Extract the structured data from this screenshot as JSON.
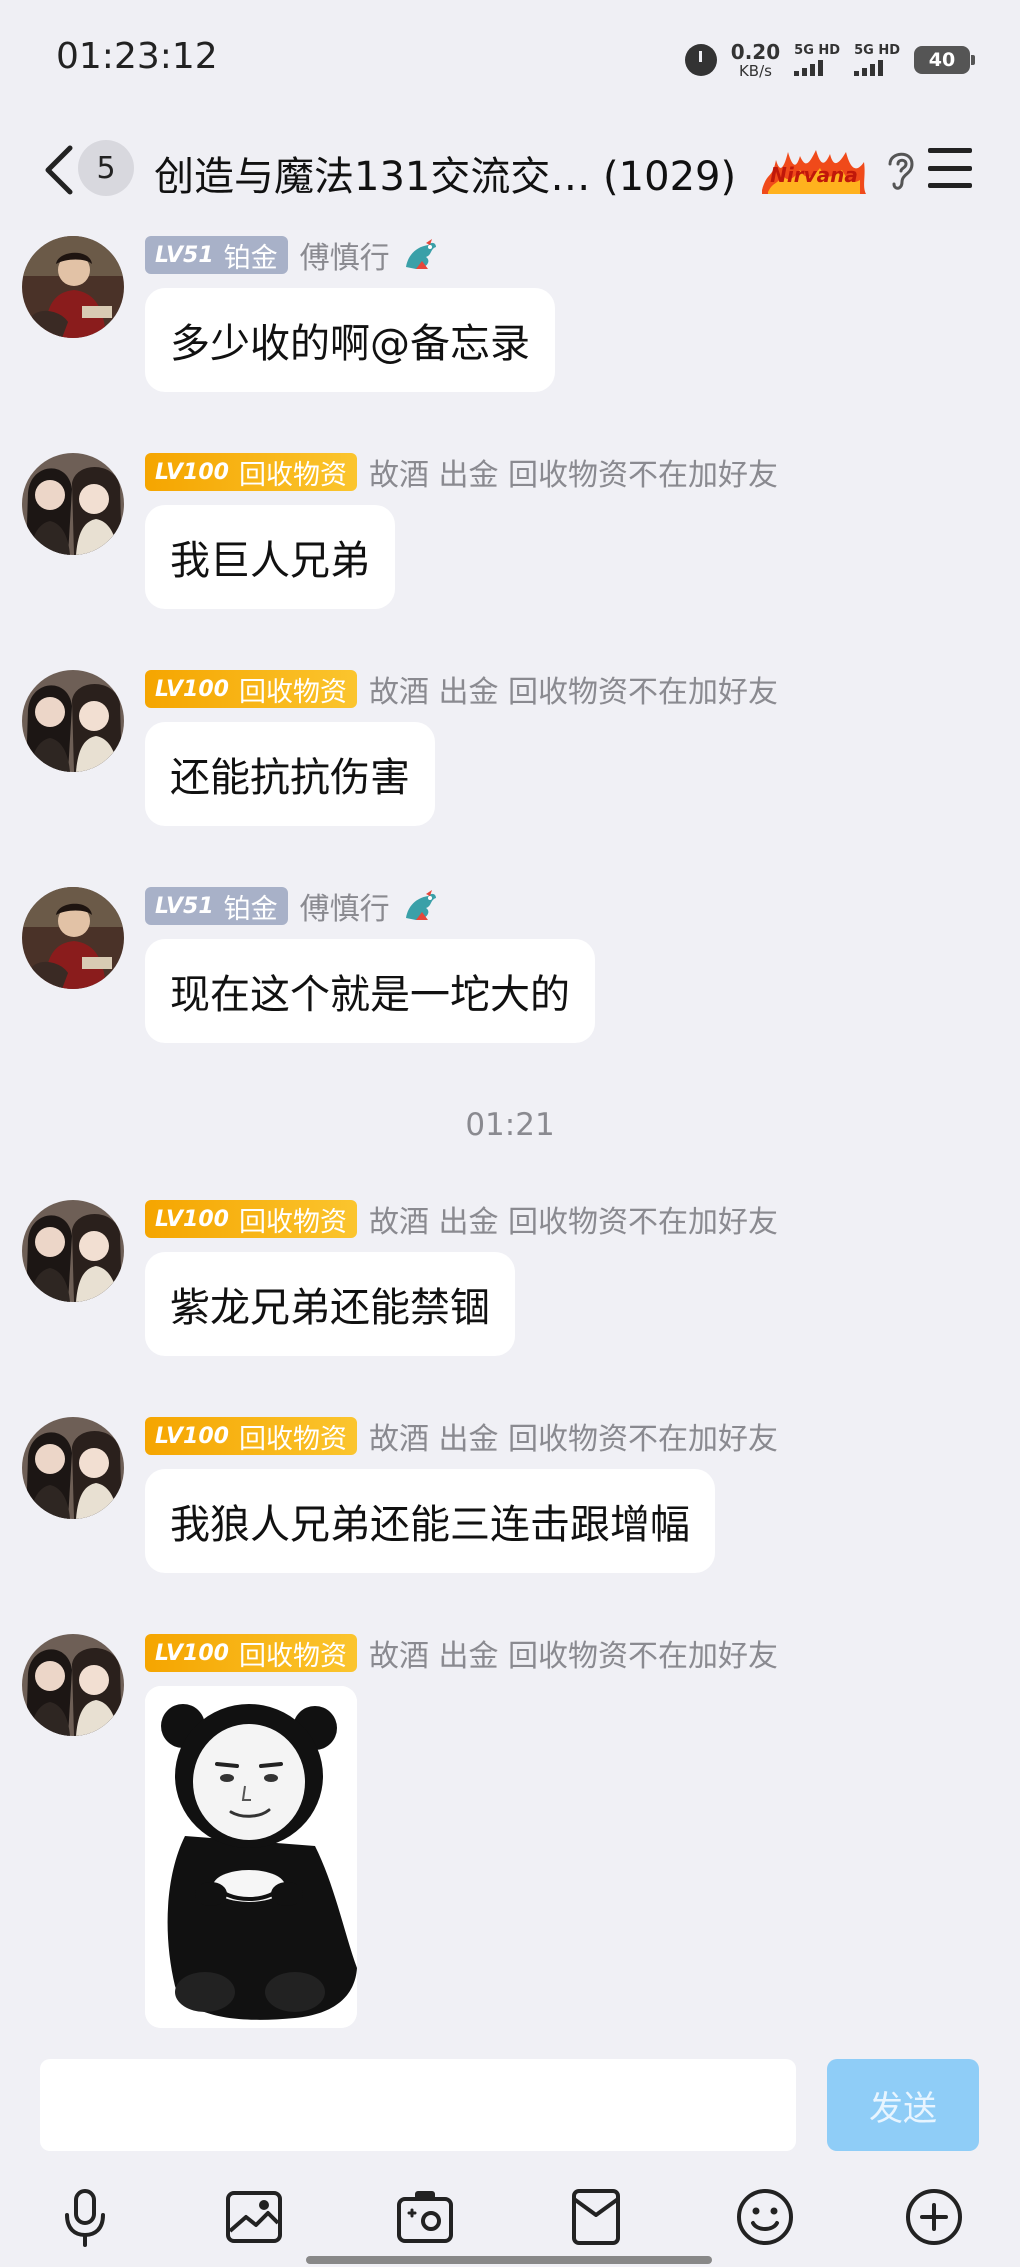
{
  "status_bar": {
    "time": "01:23:12",
    "net_speed_value": "0.20",
    "net_speed_unit": "KB/s",
    "sim1_label": "5G HD",
    "sim2_label": "5G HD",
    "battery": "40"
  },
  "header": {
    "unread_count": "5",
    "title": "创造与魔法131交流交… (1029)",
    "badge_text": "Nirvana"
  },
  "messages": [
    {
      "level": "LV51",
      "title": "铂金",
      "sender": "傅慎行",
      "text": "多少收的啊@备忘录",
      "badge": "silver"
    },
    {
      "level": "LV100",
      "title": "回收物资",
      "sender": "故酒 出金 回收物资不在加好友",
      "text": "我巨人兄弟",
      "badge": "gold"
    },
    {
      "level": "LV100",
      "title": "回收物资",
      "sender": "故酒 出金 回收物资不在加好友",
      "text": "还能抗抗伤害",
      "badge": "gold"
    },
    {
      "level": "LV51",
      "title": "铂金",
      "sender": "傅慎行",
      "text": "现在这个就是一坨大的",
      "badge": "silver"
    },
    {
      "level": "LV100",
      "title": "回收物资",
      "sender": "故酒 出金 回收物资不在加好友",
      "text": "紫龙兄弟还能禁锢",
      "badge": "gold"
    },
    {
      "level": "LV100",
      "title": "回收物资",
      "sender": "故酒 出金 回收物资不在加好友",
      "text": "我狼人兄弟还能三连击跟增幅",
      "badge": "gold"
    },
    {
      "level": "LV100",
      "title": "回收物资",
      "sender": "故酒 出金 回收物资不在加好友",
      "badge": "gold",
      "sticker": "panda-meme-sticker"
    }
  ],
  "time_separator": "01:21",
  "input": {
    "placeholder": "",
    "send_label": "发送"
  },
  "toolbar_icons": [
    "microphone-icon",
    "image-icon",
    "camera-icon",
    "file-icon",
    "emoji-icon",
    "plus-icon"
  ],
  "colors": {
    "background": "#f0f0f5",
    "gold_badge": "#f5a500",
    "silver_badge": "#a8b1c8",
    "send_button": "#8fcdf7"
  }
}
